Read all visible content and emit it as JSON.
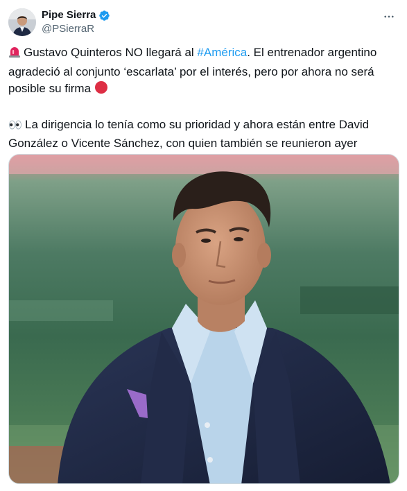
{
  "author": {
    "display_name": "Pipe Sierra",
    "handle": "@PSierraR",
    "verified": true,
    "avatar_icon": "profile-photo"
  },
  "tweet": {
    "para1": {
      "emoji_lead": "rotating-light-emoji",
      "text_before": "Gustavo Quinteros NO llegará al ",
      "hashtag": "#América",
      "text_after": ". El entrenador argentino agradeció al conjunto ‘escarlata’ por el interés, pero por ahora no será posible su firma ",
      "emoji_trail": "red-circle-emoji"
    },
    "para2": {
      "emoji_lead": "eyes-emoji",
      "text": "La dirigencia lo tenía como su prioridad y ahora están entre David González o Vicente Sánchez, con quien también se reunieron ayer"
    }
  },
  "media": {
    "type": "photo",
    "subject": "man in navy blazer and light blue shirt in a stadium"
  },
  "colors": {
    "text": "#0f1419",
    "secondary": "#536471",
    "link": "#1d9bf0",
    "verified": "#1d9bf0"
  }
}
